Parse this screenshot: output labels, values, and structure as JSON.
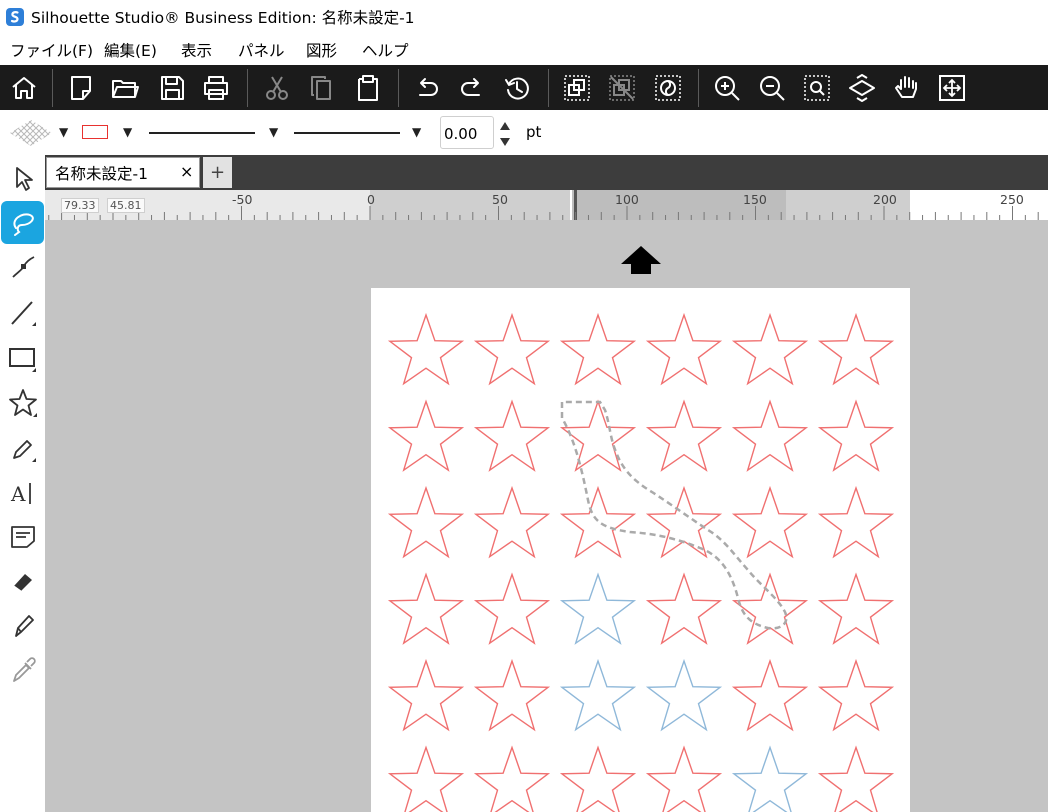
{
  "window": {
    "title": "Silhouette Studio® Business Edition: 名称未設定-1",
    "app_icon": "silhouette-app-icon"
  },
  "menubar": {
    "items": [
      "ファイル(F)",
      "編集(E)",
      "表示",
      "パネル",
      "図形",
      "ヘルプ"
    ]
  },
  "toolbar": {
    "buttons": [
      "home-icon",
      "new-document-icon",
      "open-folder-icon",
      "save-icon",
      "print-icon",
      "cut-icon",
      "copy-icon",
      "paste-icon",
      "undo-icon",
      "redo-icon",
      "history-icon",
      "group-icon",
      "ungroup-icon",
      "release-compound-icon",
      "zoom-in-icon",
      "zoom-out-icon",
      "zoom-selection-icon",
      "fit-to-page-icon",
      "pan-hand-icon",
      "fit-to-window-icon"
    ]
  },
  "properties": {
    "fill_pattern": "none",
    "line_color": "#e8322f",
    "line_width_value": "0.00",
    "unit": "pt"
  },
  "tabs": {
    "document_tab": "名称未設定-1",
    "close_glyph": "×",
    "new_tab_glyph": "+"
  },
  "ruler": {
    "coord_x": "79.33",
    "coord_y": "45.81",
    "labels": [
      "-50",
      "0",
      "50",
      "100",
      "150",
      "200",
      "250"
    ]
  },
  "left_tools": [
    "select-tool-icon",
    "freehand-select-tool-icon",
    "point-edit-tool-icon",
    "line-tool-icon",
    "rectangle-tool-icon",
    "star-tool-icon",
    "pencil-tool-icon",
    "text-tool-icon",
    "text-style-tool-icon",
    "eraser-tool-icon",
    "knife-tool-icon",
    "eyedropper-tool-icon"
  ],
  "active_tool": "freehand-select-tool-icon",
  "canvas": {
    "feed_direction_icon": "feed-direction-arrow-icon",
    "star_grid": {
      "columns": 6,
      "rows": 6
    },
    "star_color": "#f07070",
    "selected_star_color": "#8fb8d9",
    "selection_lasso_color": "#aaaaaa",
    "selected_stars": [
      [
        2,
        3
      ],
      [
        2,
        4
      ],
      [
        3,
        4
      ],
      [
        4,
        5
      ]
    ]
  }
}
